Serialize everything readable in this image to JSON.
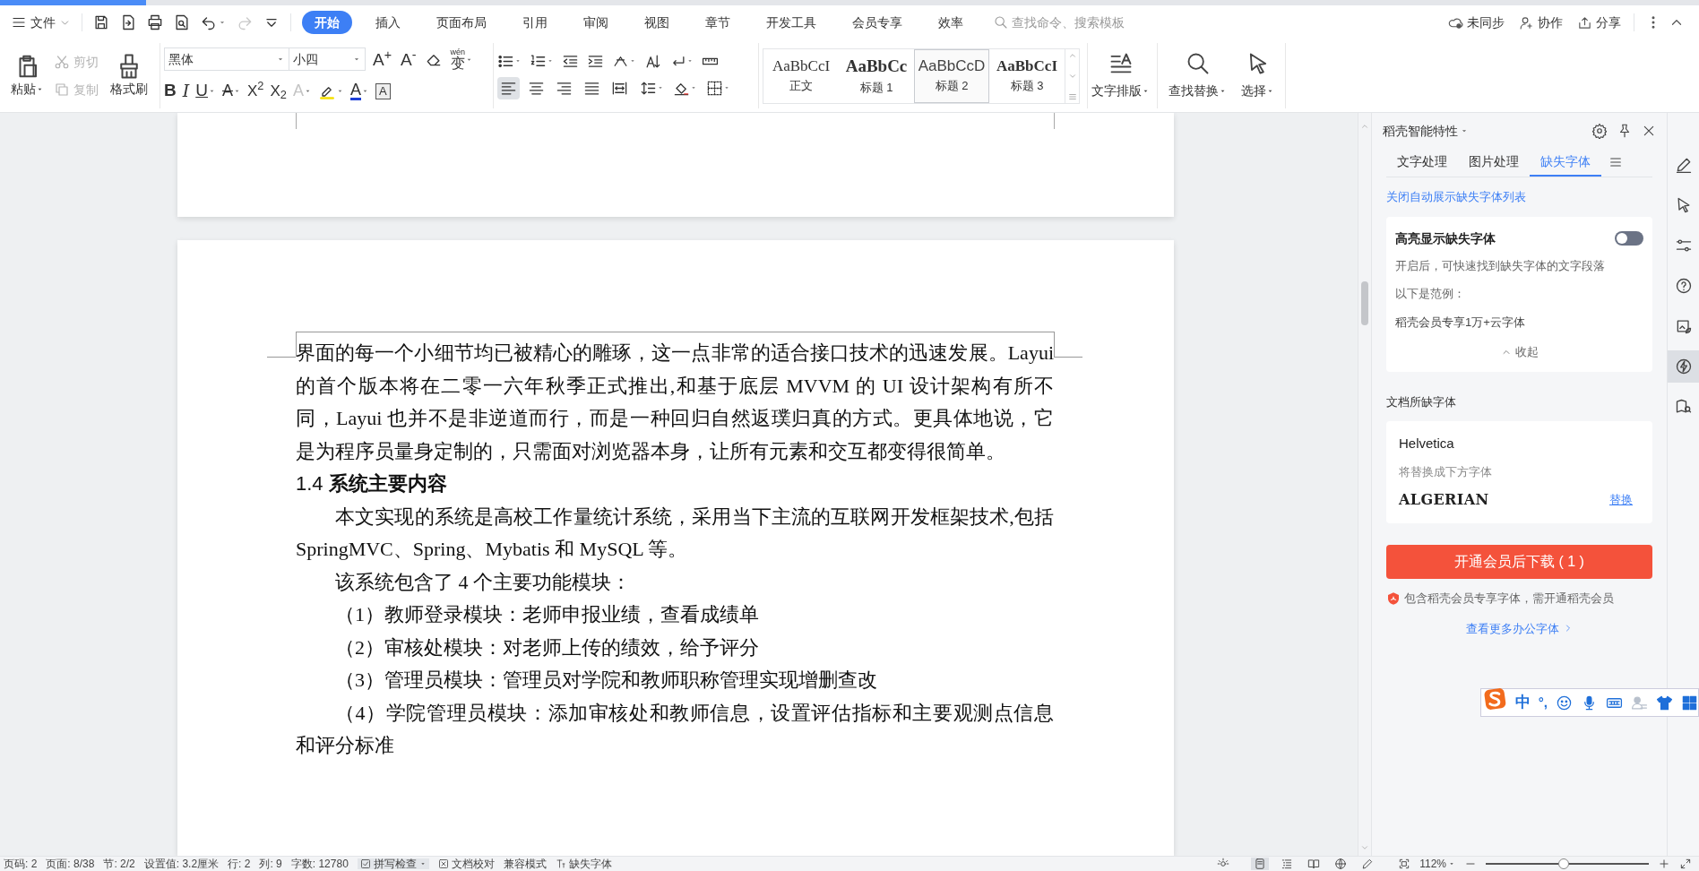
{
  "loading_bar": {
    "level": 0.086
  },
  "menu": {
    "file": "文件",
    "quick_access": [
      {
        "disabled": false
      },
      {
        "disabled": false
      },
      {
        "disabled": false
      },
      {
        "disabled": false
      },
      {
        "disabled": false
      },
      {
        "disabled": true
      },
      {
        "disabled": false
      }
    ],
    "tabs": [
      {
        "label": "开始",
        "selected": true
      },
      {
        "label": "插入",
        "selected": false
      },
      {
        "label": "页面布局",
        "selected": false
      },
      {
        "label": "引用",
        "selected": false
      },
      {
        "label": "审阅",
        "selected": false
      },
      {
        "label": "视图",
        "selected": false
      },
      {
        "label": "章节",
        "selected": false
      },
      {
        "label": "开发工具",
        "selected": false
      },
      {
        "label": "会员专享",
        "selected": false
      },
      {
        "label": "效率",
        "selected": false
      }
    ],
    "search": {
      "placeholder": "查找命令、搜索模板"
    },
    "actions": [
      "未同步",
      "协作",
      "分享"
    ]
  },
  "ribbon": {
    "clipboard": {
      "paste": "粘贴",
      "cut": {
        "label": "剪切",
        "disabled": true
      },
      "copy": {
        "label": "复制",
        "disabled": true
      },
      "format_painter": "格式刷"
    },
    "font": {
      "name": "黑体",
      "size": "小四",
      "row1": [
        {
          "kind": "grow",
          "text": "A$^{+}$"
        },
        {
          "kind": "shrink",
          "text": "A$^{-}$"
        },
        {
          "kind": "clear"
        },
        {
          "kind": "phonetic",
          "text": "wén",
          "char": "变"
        }
      ],
      "row2": [
        {
          "kind": "bold",
          "text": "B"
        },
        {
          "kind": "italic",
          "text": "I"
        },
        {
          "kind": "underline",
          "text": "U"
        },
        {
          "kind": "strike",
          "text": "A"
        },
        {
          "kind": "superscript",
          "text": "X$^{2}$"
        },
        {
          "kind": "subscript",
          "text": "X$_{2}$"
        },
        {
          "kind": "effect",
          "text": "A"
        },
        {
          "kind": "highlight"
        },
        {
          "kind": "color",
          "text": "A"
        },
        {
          "kind": "border",
          "text": "A"
        }
      ]
    },
    "paragraph_align": [
      {
        "selected": true
      },
      {
        "selected": false
      },
      {
        "selected": false
      },
      {
        "selected": false
      },
      {
        "selected": false
      }
    ],
    "styles": [
      {
        "sample": "AaBbCcI",
        "name": "正文",
        "selected": false
      },
      {
        "sample": "AaBbCc",
        "name": "标题 1",
        "selected": false
      },
      {
        "sample": "AaBbCcD",
        "name": "标题 2",
        "selected": true
      },
      {
        "sample": "AaBbCcI",
        "name": "标题 3",
        "selected": false
      }
    ],
    "text_layout": "文字排版",
    "find_replace": "查找替换",
    "select": "选择"
  },
  "document": {
    "paragraphs": [
      {
        "kind": "body",
        "indent": false,
        "text": "界面的每一个小细节均已被精心的雕琢，这一点非常的适合接口技术的迅速发展。Layui 的首个版本将在二零一六年秋季正式推出,和基于底层 MVVM 的 UI 设计架构有所不同，Layui 也并不是非逆道而行，而是一种回归自然返璞归真的方式。更具体地说，它是为程序员量身定制的，只需面对浏览器本身，让所有元素和交互都变得很简单。"
      },
      {
        "kind": "heading",
        "text": "1.4 **系统主要内容**"
      },
      {
        "kind": "body",
        "indent": true,
        "text": "本文实现的系统是高校工作量统计系统，采用当下主流的互联网开发框架技术,包括 SpringMVC、Spring、Mybatis 和 MySQL 等。"
      },
      {
        "kind": "body",
        "indent": true,
        "text": "该系统包含了 4 个主要功能模块："
      },
      {
        "kind": "body",
        "indent": true,
        "text": "（1）教师登录模块：老师申报业绩，查看成绩单"
      },
      {
        "kind": "body",
        "indent": true,
        "text": "（2）审核处模块：对老师上传的绩效，给予评分"
      },
      {
        "kind": "body",
        "indent": true,
        "text": "（3）管理员模块：管理员对学院和教师职称管理实现增删查改"
      },
      {
        "kind": "body",
        "indent": true,
        "text": "（4）学院管理员模块：添加审核处和教师信息，设置评估指标和主要观测点信息和评分标准"
      }
    ]
  },
  "panel": {
    "title": "稻壳智能特性",
    "tabs": [
      {
        "label": "文字处理",
        "selected": false
      },
      {
        "label": "图片处理",
        "selected": false
      },
      {
        "label": "缺失字体",
        "selected": true
      }
    ],
    "close_link": "关闭自动展示缺失字体列表",
    "highlight": {
      "title": "高亮显示缺失字体",
      "on": false,
      "description": "开启后，可快速找到缺失字体的文字段落",
      "example_label": "以下是范例：",
      "example": "稻壳会员专享1万+云字体",
      "collapse": "收起"
    },
    "missing_title": "文档所缺字体",
    "missing_fonts": [
      {
        "name": "Helvetica",
        "hint": "将替换成下方字体",
        "replacement": "ALGERIAN",
        "action": "替换"
      }
    ],
    "download_button": "开通会员后下载 ( 1 )",
    "note": "包含稻壳会员专享字体，需开通稻壳会员",
    "more_link": "查看更多办公字体"
  },
  "side_tools": [
    {
      "selected": false
    },
    {
      "selected": false
    },
    {
      "selected": false
    },
    {
      "selected": false
    },
    {
      "selected": false
    },
    {
      "selected": true
    },
    {
      "selected": false
    }
  ],
  "ime": {
    "mode": "中",
    "punctuation": "°,"
  },
  "status_bar": {
    "items": [
      "页码: 2",
      "页面: 8/38",
      "节: 2/2",
      "设置值: 3.2厘米",
      "行: 2",
      "列: 9",
      "字数: 12780"
    ],
    "spell_check": {
      "label": "拼写检查",
      "checked": true
    },
    "proofread": "文档校对",
    "compat_mode": "兼容模式",
    "missing_fonts": "缺失字体",
    "view_modes": [
      {
        "selected": true
      },
      {
        "selected": false
      },
      {
        "selected": false
      },
      {
        "selected": false
      },
      {
        "selected": false
      }
    ],
    "zoom": "112%",
    "zoom_slider": {
      "level": 0.48
    }
  }
}
